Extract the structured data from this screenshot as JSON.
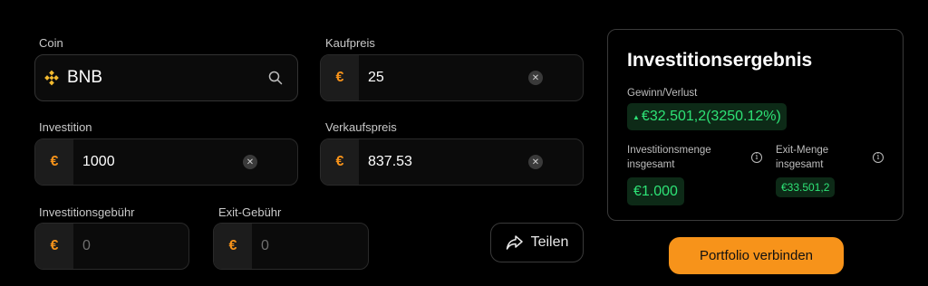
{
  "colors": {
    "accent": "#f7931a",
    "profit": "#2ee276",
    "background": "#000000"
  },
  "coin": {
    "label": "Coin",
    "value": "BNB",
    "icon": "bnb-logo-icon"
  },
  "kaufpreis": {
    "label": "Kaufpreis",
    "currency": "€",
    "value": "25"
  },
  "investition": {
    "label": "Investition",
    "currency": "€",
    "value": "1000"
  },
  "verkaufspreis": {
    "label": "Verkaufspreis",
    "currency": "€",
    "value": "837.53"
  },
  "investitionsgebuehr": {
    "label": "Investitionsgebühr",
    "currency": "€",
    "placeholder": "0"
  },
  "exitgebuehr": {
    "label": "Exit-Gebühr",
    "currency": "€",
    "placeholder": "0"
  },
  "share": {
    "label": "Teilen"
  },
  "result": {
    "title": "Investitionsergebnis",
    "gain_label": "Gewinn/Verlust",
    "gain_value": "€32.501,2(3250.12%)",
    "invest_total_label_line1": "Investitionsmenge",
    "invest_total_label_line2": "insgesamt",
    "invest_total_value": "€1.000",
    "exit_total_label_line1": "Exit-Menge",
    "exit_total_label_line2": "insgesamt",
    "exit_total_value": "€33.501,2"
  },
  "connect_button": {
    "label": "Portfolio verbinden"
  }
}
